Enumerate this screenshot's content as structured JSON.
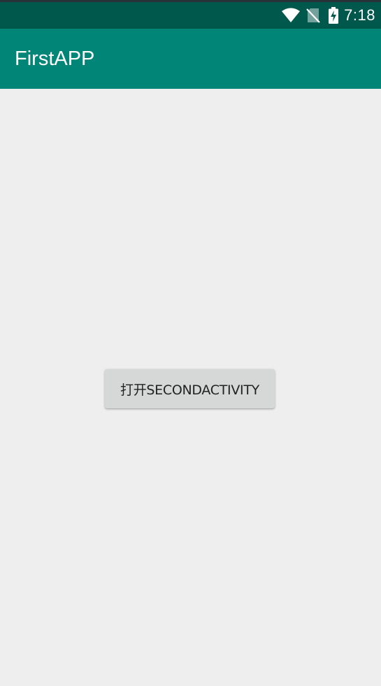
{
  "status_bar": {
    "time": "7:18",
    "icons": [
      "wifi-icon",
      "signal-off-icon",
      "battery-charging-icon"
    ],
    "background": "#00574b"
  },
  "app_bar": {
    "title": "FirstAPP",
    "background": "#008577"
  },
  "main": {
    "open_button_label": "打开SECONDACTIVITY",
    "background": "#eeeeee"
  }
}
